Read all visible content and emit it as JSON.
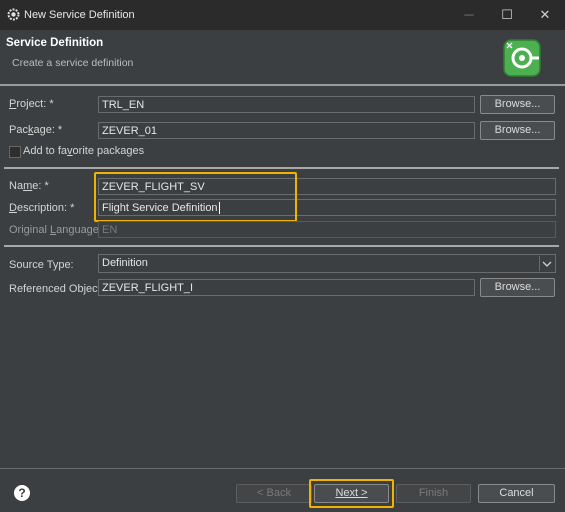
{
  "window": {
    "title": "New Service Definition",
    "icons": {
      "app": "gear-icon",
      "minimize": "minimize-icon",
      "maximize": "maximize-icon",
      "close": "close-icon"
    }
  },
  "header": {
    "title": "Service Definition",
    "subtitle": "Create a service definition",
    "icon": "service-definition-wizard-icon"
  },
  "form": {
    "project": {
      "label_pre": "",
      "label_ul": "P",
      "label_post": "roject: *",
      "value": "TRL_EN",
      "browse": "Browse..."
    },
    "package": {
      "label_pre": "Pac",
      "label_ul": "k",
      "label_post": "age: *",
      "value": "ZEVER_01",
      "browse": "Browse..."
    },
    "favorites": {
      "label_pre": "Add to fa",
      "label_ul": "v",
      "label_post": "orite packages",
      "checked": false
    },
    "name": {
      "label_pre": "Na",
      "label_ul": "m",
      "label_post": "e: *",
      "value": "ZEVER_FLIGHT_SV"
    },
    "description": {
      "label_pre": "",
      "label_ul": "D",
      "label_post": "escription: *",
      "value": "Flight Service Definition"
    },
    "original_language": {
      "label_pre": "Original ",
      "label_ul": "L",
      "label_post": "anguage:",
      "value": "EN"
    },
    "source_type": {
      "label": "Source Type:",
      "value": "Definition"
    },
    "referenced_object": {
      "label": "Referenced Object:",
      "value": "ZEVER_FLIGHT_I",
      "browse": "Browse..."
    }
  },
  "footer": {
    "help_icon": "help-icon",
    "help_glyph": "?",
    "back": "< Back",
    "next": "Next >",
    "finish": "Finish",
    "cancel": "Cancel"
  },
  "colors": {
    "highlight": "#f0b400",
    "background": "#3c3f41",
    "wizard_icon": "#4caf50"
  }
}
